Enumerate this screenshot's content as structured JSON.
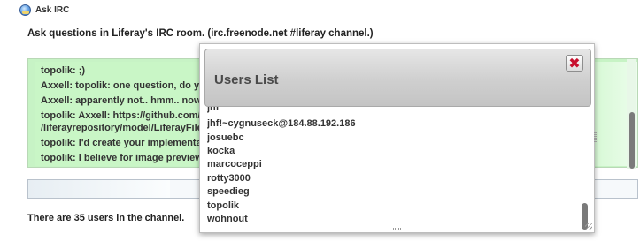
{
  "portlet": {
    "title": "Ask IRC"
  },
  "intro": "Ask questions in Liferay's IRC room. (irc.freenode.net #liferay channel.)",
  "chat": {
    "lines": [
      "topolik: ;)",
      "Axxell: topolik: one question, do yo",
      "Axxell: apparently not.. hmm.. now",
      "topolik: Axxell: https://github.com/",
      "/liferayrepository/model/LiferayFile",
      "topolik: I'd create your implementat",
      "topolik: I believe for image previews"
    ]
  },
  "footer": {
    "user_count": "There are 35 users in the channel."
  },
  "dialog": {
    "title": "Users List",
    "close_label": "✖",
    "users": [
      "jhf",
      "jhf!~cygnuseck@184.88.192.186",
      "josuebc",
      "kocka",
      "marcoceppi",
      "rotty3000",
      "speedieg",
      "topolik",
      "wohnout"
    ]
  },
  "colors": {
    "chat_background": "#c7f3c5",
    "close_x": "#c8102e",
    "dialog_header": "#cfcfcf"
  }
}
